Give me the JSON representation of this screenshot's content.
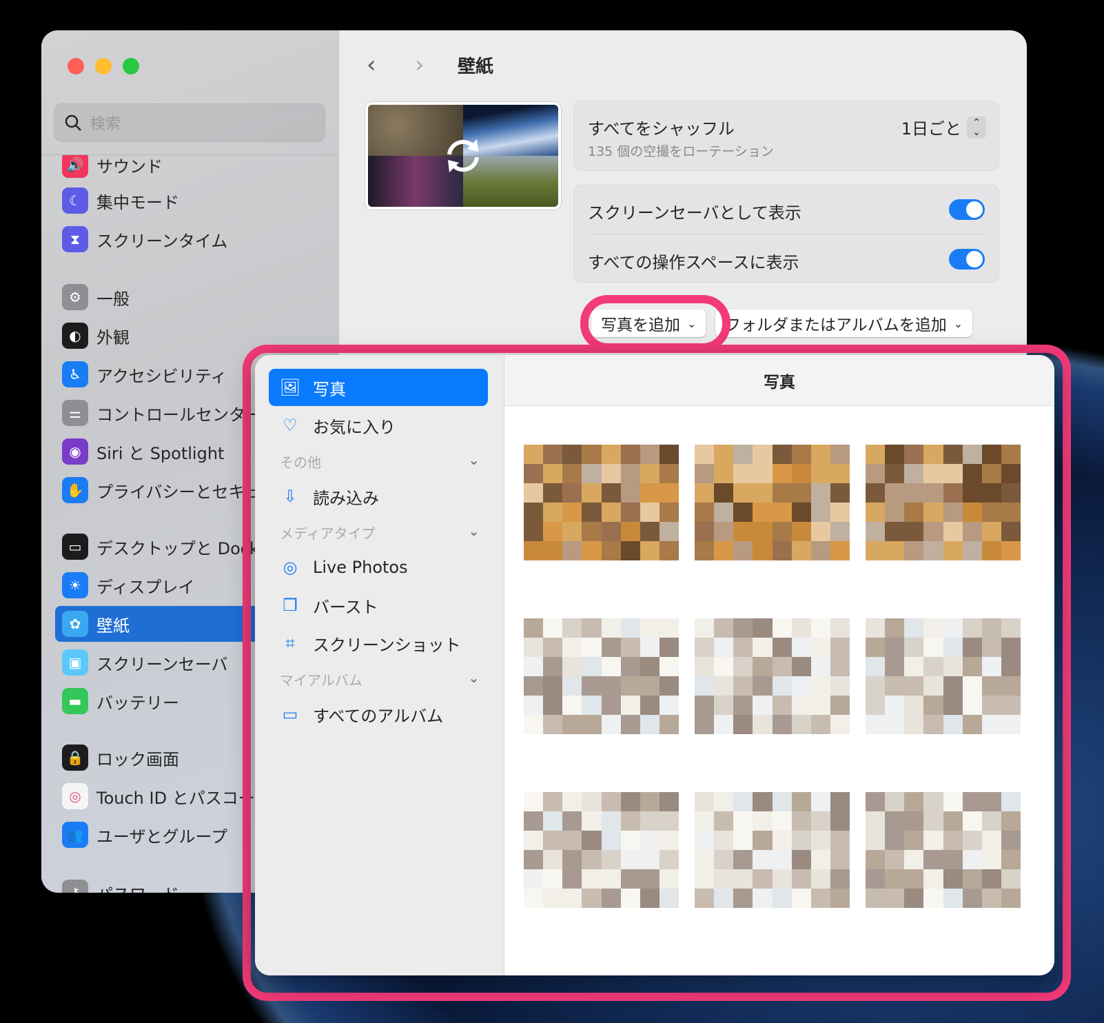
{
  "window": {
    "title": "壁紙",
    "back_icon": "chevron-left-icon",
    "forward_icon": "chevron-right-icon"
  },
  "search": {
    "placeholder": "検索"
  },
  "sidebar": {
    "items": [
      {
        "label": "サウンド",
        "icon": "speaker-icon",
        "color": "#f2355b"
      },
      {
        "label": "集中モード",
        "icon": "moon-icon",
        "color": "#5e5ce6"
      },
      {
        "label": "スクリーンタイム",
        "icon": "hourglass-icon",
        "color": "#5e5ce6"
      },
      {
        "label": "一般",
        "icon": "gear-icon",
        "color": "#8e8e93"
      },
      {
        "label": "外観",
        "icon": "appearance-icon",
        "color": "#1c1c1e"
      },
      {
        "label": "アクセシビリティ",
        "icon": "accessibility-icon",
        "color": "#1a7cf5"
      },
      {
        "label": "コントロールセンター",
        "icon": "switches-icon",
        "color": "#8e8e93"
      },
      {
        "label": "Siri と Spotlight",
        "icon": "siri-icon",
        "color": "#7a3cc8"
      },
      {
        "label": "プライバシーとセキュリティ",
        "icon": "hand-icon",
        "color": "#1a7cf5"
      },
      {
        "label": "デスクトップと Dock",
        "icon": "dock-icon",
        "color": "#1c1c1e"
      },
      {
        "label": "ディスプレイ",
        "icon": "sun-icon",
        "color": "#1a7cf5"
      },
      {
        "label": "壁紙",
        "icon": "flower-icon",
        "color": "#3aa8f0",
        "selected": true
      },
      {
        "label": "スクリーンセーバ",
        "icon": "screensaver-icon",
        "color": "#5ac8fa"
      },
      {
        "label": "バッテリー",
        "icon": "battery-icon",
        "color": "#34c759"
      },
      {
        "label": "ロック画面",
        "icon": "lock-icon",
        "color": "#1c1c1e"
      },
      {
        "label": "Touch ID とパスコード",
        "icon": "fingerprint-icon",
        "color": "#f5f5f5"
      },
      {
        "label": "ユーザとグループ",
        "icon": "users-icon",
        "color": "#1a7cf5"
      },
      {
        "label": "パスワード",
        "icon": "key-icon",
        "color": "#8e8e93"
      }
    ]
  },
  "shuffle": {
    "title": "すべてをシャッフル",
    "subtitle": "135 個の空撮をローテーション",
    "frequency": "1日ごと"
  },
  "options": [
    {
      "label": "スクリーンセーバとして表示",
      "on": true
    },
    {
      "label": "すべての操作スペースに表示",
      "on": true
    }
  ],
  "buttons": {
    "add_photo": "写真を追加",
    "add_folder": "フォルダまたはアルバムを追加"
  },
  "highlight_color": "#f23a78",
  "picker": {
    "header": "写真",
    "items": [
      {
        "label": "写真",
        "icon": "photos-icon",
        "selected": true
      },
      {
        "label": "お気に入り",
        "icon": "heart-icon"
      },
      {
        "section": "その他"
      },
      {
        "label": "読み込み",
        "icon": "import-icon"
      },
      {
        "section": "メディアタイプ"
      },
      {
        "label": "Live Photos",
        "icon": "live-photo-icon"
      },
      {
        "label": "バースト",
        "icon": "burst-icon"
      },
      {
        "label": "スクリーンショット",
        "icon": "screenshot-icon"
      },
      {
        "section": "マイアルバム"
      },
      {
        "label": "すべてのアルバム",
        "icon": "albums-icon"
      }
    ]
  }
}
